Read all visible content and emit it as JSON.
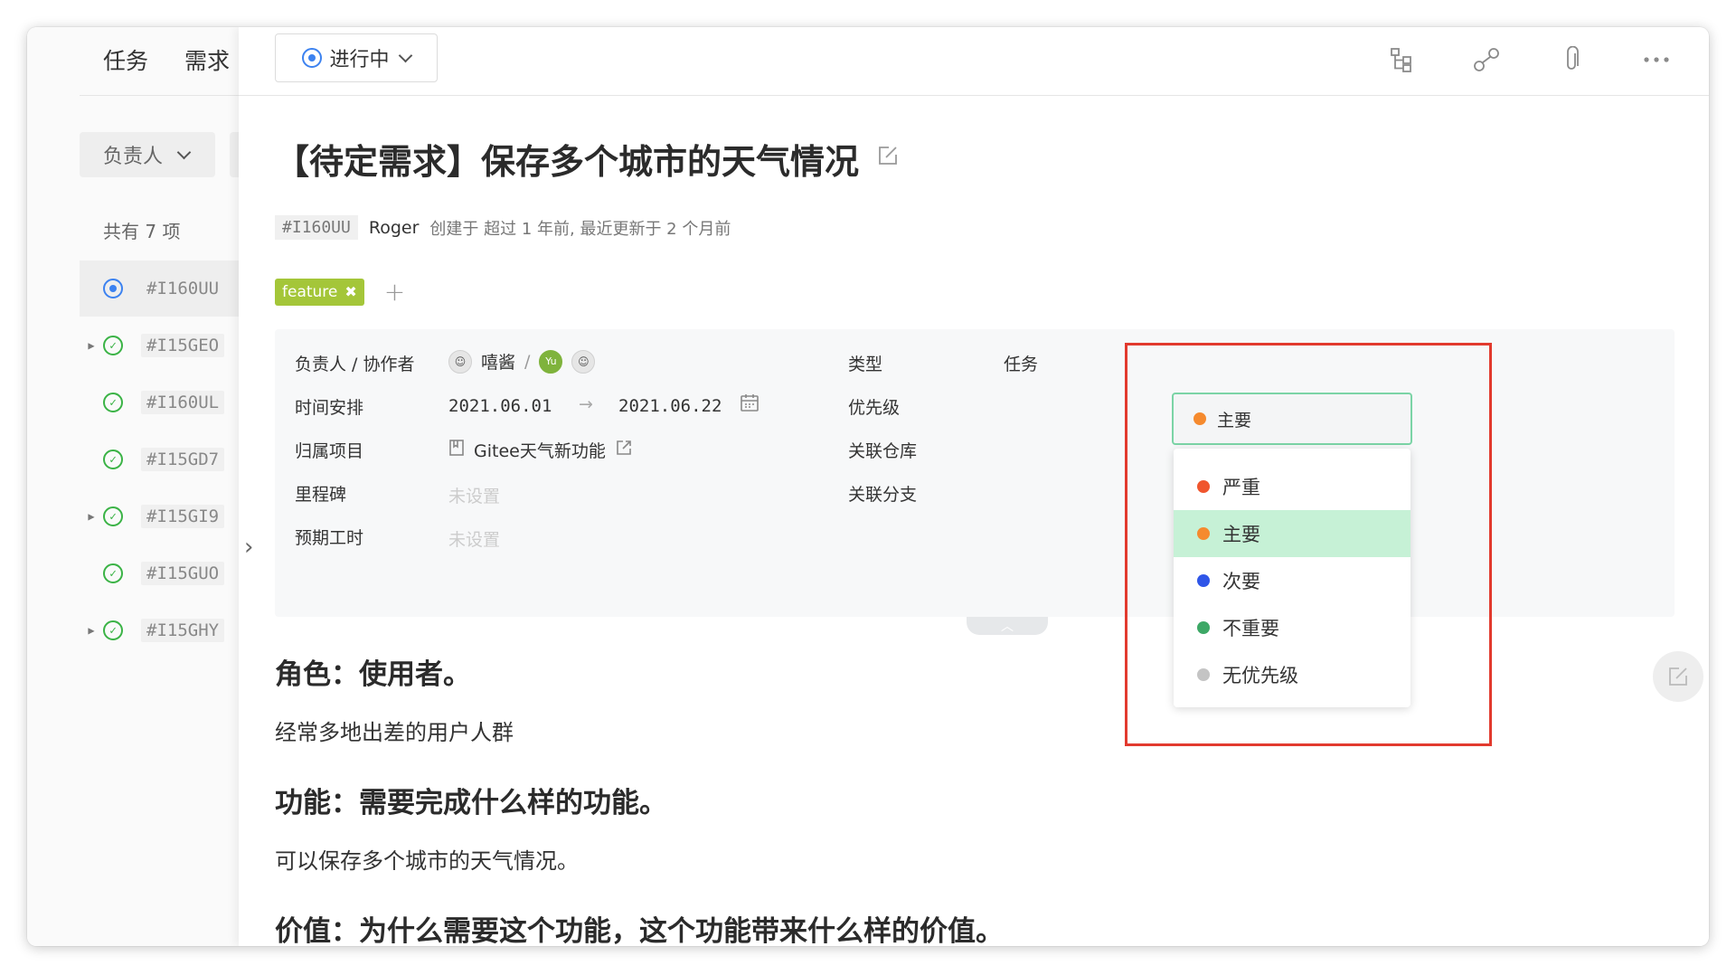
{
  "left_panel": {
    "tabs": [
      "任务",
      "需求"
    ],
    "filter_label": "负责人",
    "count_text": "共有 7 项",
    "items": [
      {
        "id": "#I160UU",
        "status": "in-progress",
        "expandable": false,
        "active": true
      },
      {
        "id": "#I15GEO",
        "status": "done",
        "expandable": true,
        "active": false
      },
      {
        "id": "#I160UL",
        "status": "done",
        "expandable": false,
        "active": false
      },
      {
        "id": "#I15GD7",
        "status": "done",
        "expandable": false,
        "active": false
      },
      {
        "id": "#I15GI9",
        "status": "done",
        "expandable": true,
        "active": false
      },
      {
        "id": "#I15GUO",
        "status": "done",
        "expandable": false,
        "active": false
      },
      {
        "id": "#I15GHY",
        "status": "done",
        "expandable": true,
        "active": false
      }
    ]
  },
  "toolbar": {
    "status_label": "进行中",
    "icons": [
      "tree-icon",
      "relation-icon",
      "attachment-icon",
      "more-icon"
    ]
  },
  "issue": {
    "title": "【待定需求】保存多个城市的天气情况",
    "id": "#I160UU",
    "author": "Roger",
    "meta_text": "创建于 超过 1 年前, 最近更新于 2 个月前",
    "tags": [
      {
        "label": "feature",
        "color": "#a4c639"
      }
    ]
  },
  "fields": {
    "assignee_label": "负责人 / 协作者",
    "assignee_name": "嘻酱",
    "separator": "/",
    "collaborator_initials": "Yu",
    "schedule_label": "时间安排",
    "start_date": "2021.06.01",
    "arrow": "→",
    "end_date": "2021.06.22",
    "project_label": "归属项目",
    "project_name": "Gitee天气新功能",
    "milestone_label": "里程碑",
    "milestone_value": "未设置",
    "estimate_label": "预期工时",
    "estimate_value": "未设置",
    "type_label": "类型",
    "type_value": "任务",
    "priority_label": "优先级",
    "priority_value": "主要",
    "repo_label": "关联仓库",
    "branch_label": "关联分支"
  },
  "priority_options": [
    {
      "label": "严重",
      "color": "#f0562e",
      "selected": false
    },
    {
      "label": "主要",
      "color": "#f58a2e",
      "selected": true
    },
    {
      "label": "次要",
      "color": "#2f56e8",
      "selected": false
    },
    {
      "label": "不重要",
      "color": "#3da866",
      "selected": false
    },
    {
      "label": "无优先级",
      "color": "#c4c4c4",
      "selected": false
    }
  ],
  "description": {
    "h_role": "角色：使用者。",
    "p_role": "经常多地出差的用户人群",
    "h_feature": "功能：需要完成什么样的功能。",
    "p_feature": "可以保存多个城市的天气情况。",
    "h_value": "价值：为什么需要这个功能，这个功能带来什么样的价值。"
  },
  "colors": {
    "accent_blue": "#3c82f0",
    "done_green": "#3bb346",
    "highlight_red": "#e23a2e",
    "select_border": "#7bd4a6",
    "selected_bg": "#c6f1d6"
  }
}
